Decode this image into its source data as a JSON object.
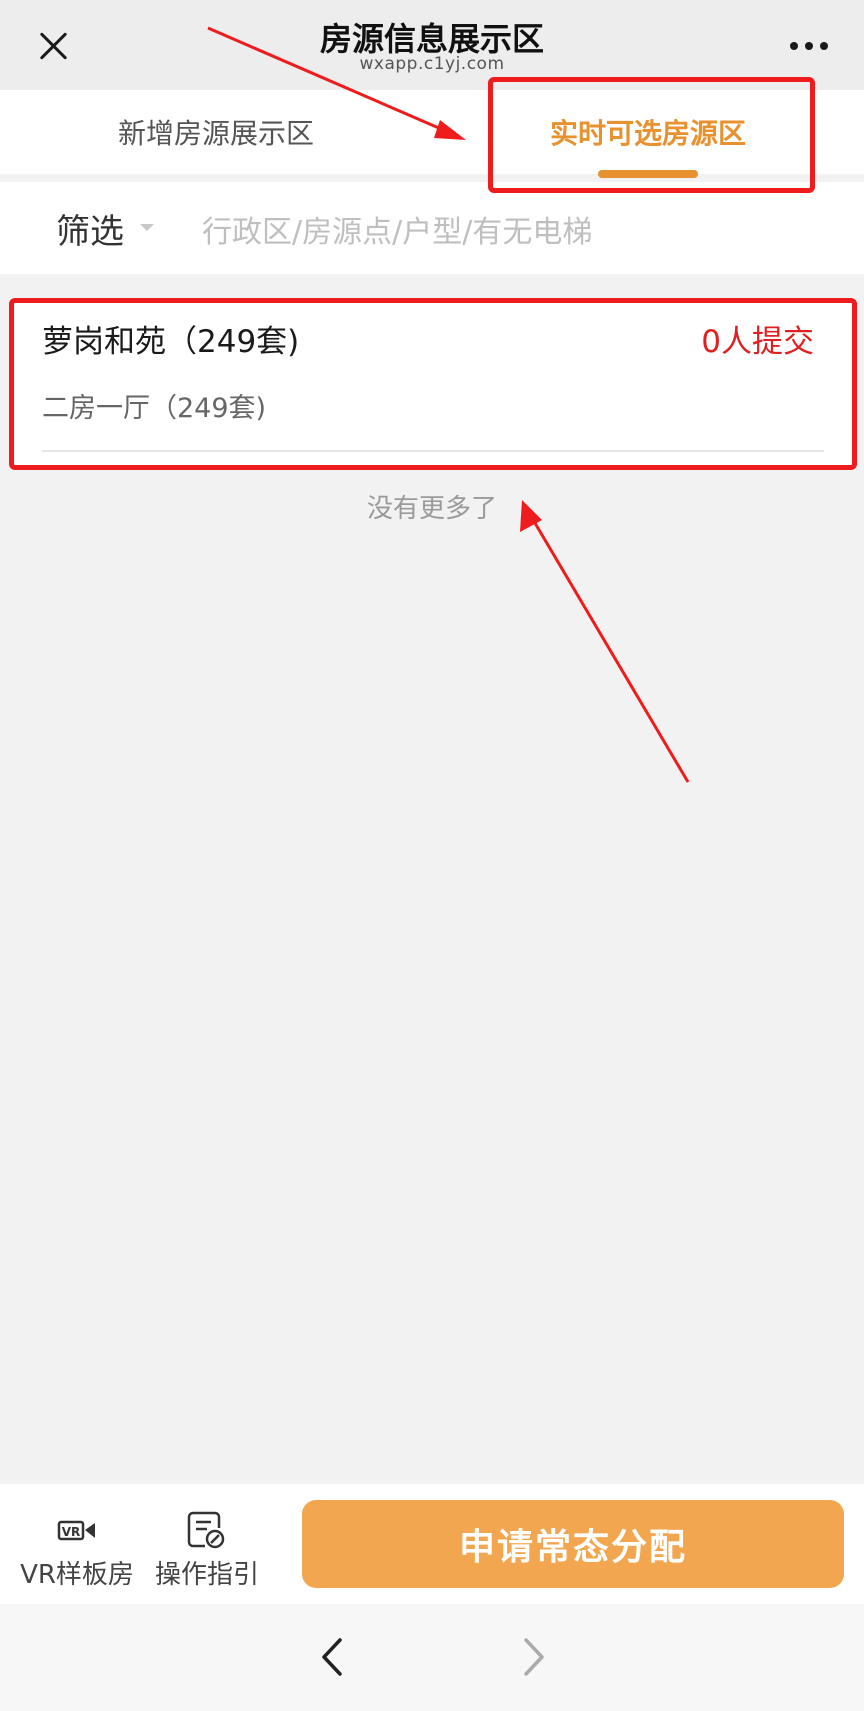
{
  "titlebar": {
    "title": "房源信息展示区",
    "domain": "wxapp.c1yj.com"
  },
  "tabs": [
    {
      "label": "新增房源展示区",
      "active": false
    },
    {
      "label": "实时可选房源区",
      "active": true
    }
  ],
  "filter": {
    "label": "筛选",
    "placeholder": "行政区/房源点/户型/有无电梯"
  },
  "listing": {
    "name": "萝岗和苑（249套)",
    "submitted": "0人提交",
    "type": "二房一厅（249套)"
  },
  "list_end_text": "没有更多了",
  "bottom_bar": {
    "vr_label": "VR样板房",
    "guide_label": "操作指引",
    "apply_label": "申请常态分配"
  },
  "colors": {
    "accent": "#e8912f",
    "apply_button": "#f2a650",
    "submitted_text": "#e02020",
    "annotation": "#ee1c1c"
  },
  "icons": [
    "close-icon",
    "more-icon",
    "caret-down-icon",
    "vr-icon",
    "guide-icon",
    "back-chevron-icon",
    "forward-chevron-icon"
  ]
}
